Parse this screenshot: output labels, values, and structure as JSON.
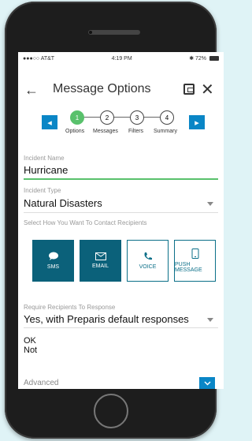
{
  "status": {
    "carrier": "●●●○○ AT&T",
    "time": "4:19 PM",
    "battery": "72%"
  },
  "header": {
    "title": "Message Options",
    "back_icon": "←",
    "close_icon": "✕"
  },
  "stepper": {
    "steps": [
      {
        "num": "1",
        "label": "Options",
        "active": true
      },
      {
        "num": "2",
        "label": "Messages",
        "active": false
      },
      {
        "num": "3",
        "label": "Filters",
        "active": false
      },
      {
        "num": "4",
        "label": "Summary",
        "active": false
      }
    ],
    "prev_arrow": "◂",
    "next_arrow": "▸"
  },
  "form": {
    "incident_name_label": "Incident Name",
    "incident_name_value": "Hurricane",
    "incident_type_label": "Incident Type",
    "incident_type_value": "Natural Disasters",
    "contact_label": "Select How You Want To Contact Recipients",
    "contact_options": [
      {
        "label": "SMS"
      },
      {
        "label": "EMAIL"
      },
      {
        "label": "VOICE"
      },
      {
        "label": "PUSH MESSAGE"
      }
    ],
    "response_label": "Require Recipients To Response",
    "response_value": "Yes, with Preparis default responses",
    "responses": [
      "OK",
      "Not"
    ],
    "advanced_label": "Advanced"
  },
  "colors": {
    "accent_blue": "#0a86c6",
    "dark_teal": "#0b617a",
    "green": "#59c16c"
  }
}
